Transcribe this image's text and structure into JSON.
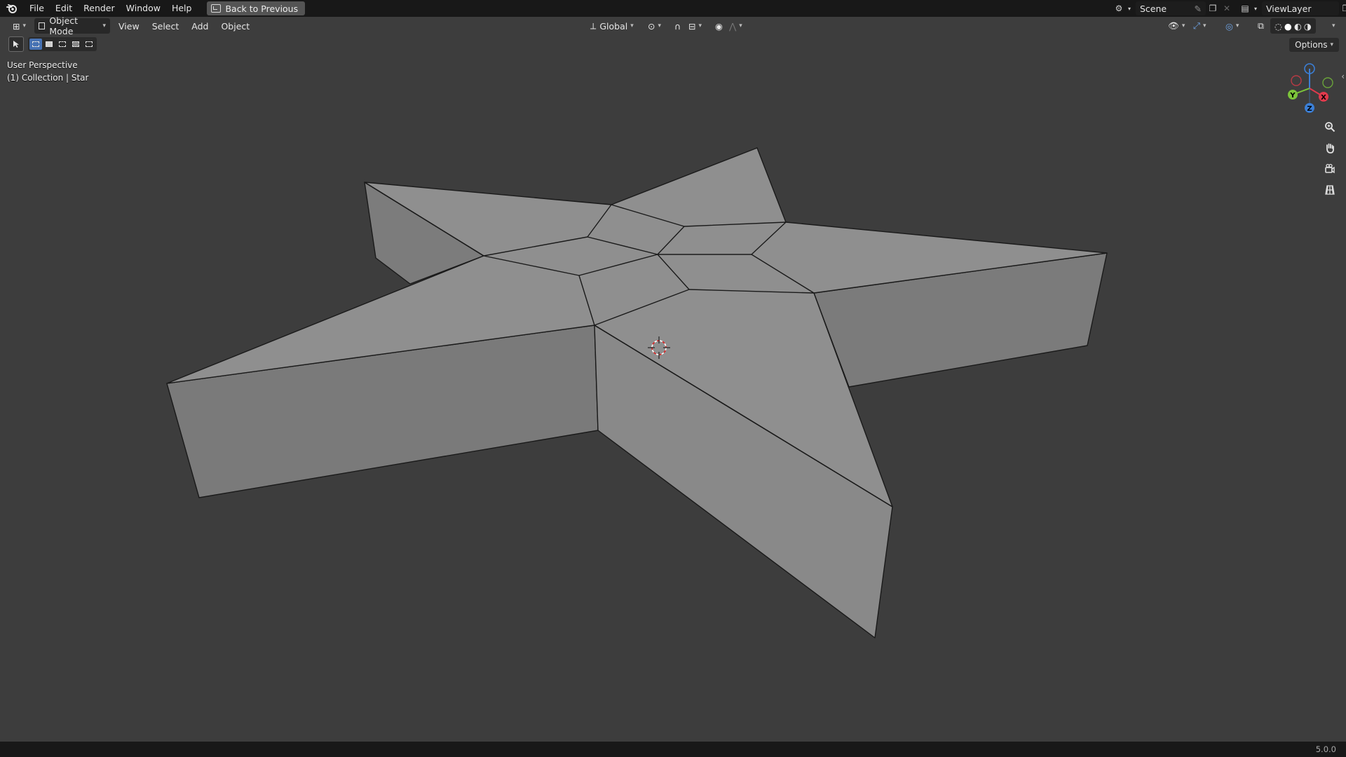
{
  "menu": {
    "items": [
      "File",
      "Edit",
      "Render",
      "Window",
      "Help"
    ],
    "back_button": "Back to Previous"
  },
  "scene": {
    "label": "Scene",
    "view_layer": "ViewLayer"
  },
  "viewport_header": {
    "mode": "Object Mode",
    "menus": [
      "View",
      "Select",
      "Add",
      "Object"
    ],
    "transform_orientation": "Global",
    "options": "Options"
  },
  "overlay": {
    "perspective": "User Perspective",
    "collection": "(1) Collection | Star"
  },
  "gizmo": {
    "x": "X",
    "y": "Y",
    "z": "Z"
  },
  "status": {
    "version": "5.0.0"
  },
  "colors": {
    "bg": "#3d3d3d",
    "topbar": "#181818",
    "top_face": "#8f8f8f",
    "side_face_dark": "#7b7b7b",
    "side_face_mid": "#868686",
    "x_axis": "#e03a4c",
    "y_axis": "#7cc43a",
    "z_axis": "#3b7fd6"
  },
  "icons": [
    "blender-logo-icon",
    "editor-type-icon",
    "select-tool-icon",
    "zoom-icon",
    "hand-pan-icon",
    "camera-icon",
    "grid-icon",
    "3d-cursor-icon"
  ]
}
